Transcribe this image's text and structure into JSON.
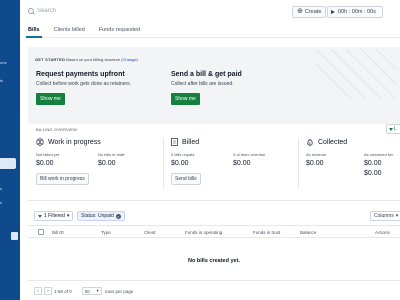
{
  "sidebar": {
    "stub_text_1": "ons",
    "stub_text_2": "ts",
    "stub_text_3": "s",
    "stub_text_4": "s"
  },
  "header": {
    "search_placeholder": "Search",
    "create_label": "Create",
    "timer_value": "00h : 00m : 00s"
  },
  "tabs": [
    {
      "label": "Bills"
    },
    {
      "label": "Clients billed"
    },
    {
      "label": "Funds requested"
    }
  ],
  "get_started": {
    "heading": "GET STARTED",
    "subheading": "Based on your billing structure",
    "change_link": "(Change)",
    "cards": [
      {
        "title": "Request payments upfront",
        "subtitle": "Collect before work gets done as retainers.",
        "button": "Show me"
      },
      {
        "title": "Send a bill & get paid",
        "subtitle": "Collect after bills are issued.",
        "button": "Show me"
      }
    ]
  },
  "billing_overview": {
    "label": "BILLING OVERVIEW",
    "filter_label": "L",
    "columns": [
      {
        "title": "Work in progress",
        "icon": "hourglass-icon",
        "stats": [
          {
            "label": "Not billed yet",
            "value": "$0.00"
          },
          {
            "label": "No bills in draft",
            "value": "$0.00"
          }
        ],
        "button": "Bill work in progress"
      },
      {
        "title": "Billed",
        "icon": "document-icon",
        "stats": [
          {
            "label": "0 bills unpaid",
            "value": "$0.00"
          },
          {
            "label": "0 of them overdue",
            "value": "$0.00"
          }
        ],
        "button": "Send bills"
      },
      {
        "title": "Collected",
        "icon": "money-bag-icon",
        "stats": [
          {
            "label": "As revenue",
            "value": "$0.00"
          },
          {
            "label": "As unearned fun",
            "value": "$0.00"
          }
        ],
        "extra_value": "$0.00"
      }
    ]
  },
  "filters": {
    "filtered_label": "1 Filtered",
    "status_label": "Status: Unpaid",
    "columns_label": "Columns"
  },
  "table": {
    "headers": [
      "Bill ID",
      "Type",
      "Client",
      "Funds in operating",
      "Funds in trust",
      "Balance",
      "Actions"
    ],
    "empty_message": "No bills created yet."
  },
  "pagination": {
    "range": "1-50 of 0",
    "page_size": "50",
    "rows_label": "rows per page"
  },
  "colors": {
    "sidebar": "#0e4a8c",
    "primary_green": "#15803d",
    "tab_underline": "#0e7490",
    "card_bg": "#f3f4f6"
  }
}
